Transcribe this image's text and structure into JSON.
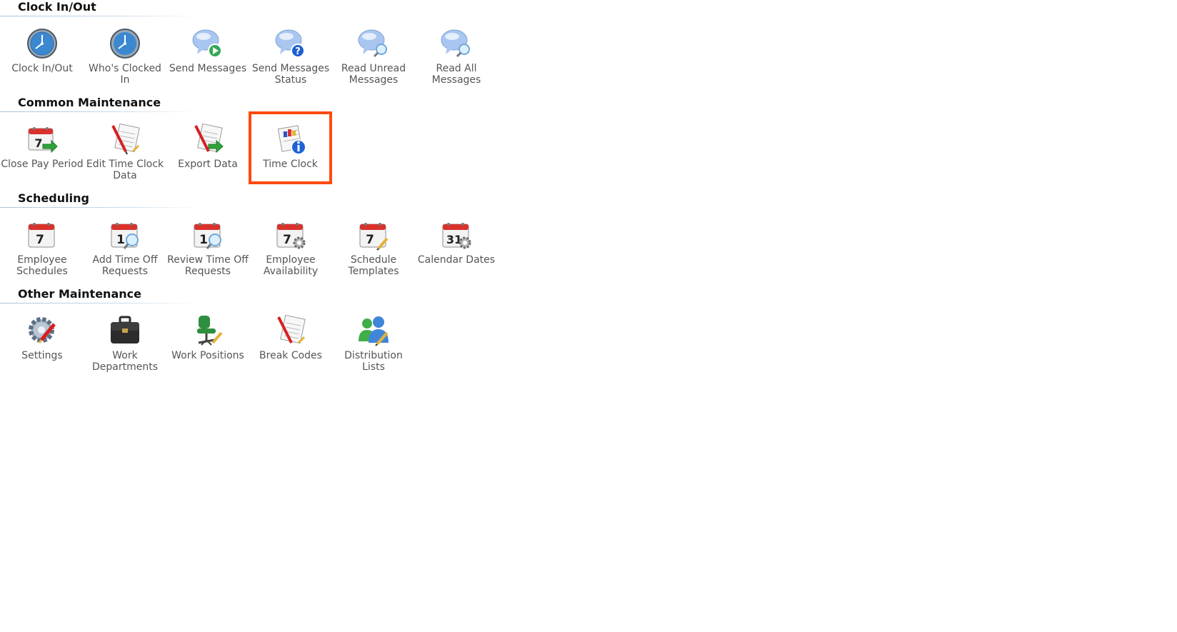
{
  "colors": {
    "section_title": "#111111",
    "label": "#555555",
    "rule": "#a9c3da",
    "highlight": "#ff4a0e"
  },
  "sections": [
    {
      "title": "Clock In/Out",
      "items": [
        {
          "label": "Clock In/Out",
          "icon": "clock-icon"
        },
        {
          "label": "Who's Clocked In",
          "icon": "clock-icon"
        },
        {
          "label": "Send Messages",
          "icon": "chat-bubble-play-icon"
        },
        {
          "label": "Send Messages Status",
          "icon": "chat-bubble-question-icon"
        },
        {
          "label": "Read Unread Messages",
          "icon": "chat-bubble-magnifier-icon"
        },
        {
          "label": "Read All Messages",
          "icon": "chat-bubble-magnifier-icon"
        }
      ]
    },
    {
      "title": "Common Maintenance",
      "items": [
        {
          "label": "Close Pay Period",
          "icon": "calendar-arrow-icon"
        },
        {
          "label": "Edit Time Clock Data",
          "icon": "timesheet-pencil-icon"
        },
        {
          "label": "Export Data",
          "icon": "timesheet-arrow-icon"
        },
        {
          "label": "Time Clock",
          "icon": "time-clock-info-icon",
          "selected": true
        }
      ]
    },
    {
      "title": "Scheduling",
      "items": [
        {
          "label": "Employee Schedules",
          "icon": "calendar-7-icon"
        },
        {
          "label": "Add Time Off Requests",
          "icon": "calendar-1-magnifier-icon"
        },
        {
          "label": "Review Time Off Requests",
          "icon": "calendar-1-magnifier-icon"
        },
        {
          "label": "Employee Availability",
          "icon": "calendar-7-gear-icon"
        },
        {
          "label": "Schedule Templates",
          "icon": "calendar-7-pencil-icon"
        },
        {
          "label": "Calendar Dates",
          "icon": "calendar-31-gear-icon"
        }
      ]
    },
    {
      "title": "Other Maintenance",
      "items": [
        {
          "label": "Settings",
          "icon": "gear-pencil-icon"
        },
        {
          "label": "Work Departments",
          "icon": "briefcase-icon"
        },
        {
          "label": "Work Positions",
          "icon": "office-chair-icon"
        },
        {
          "label": "Break Codes",
          "icon": "document-pencil-icon"
        },
        {
          "label": "Distribution Lists",
          "icon": "users-pencil-icon"
        }
      ]
    }
  ]
}
